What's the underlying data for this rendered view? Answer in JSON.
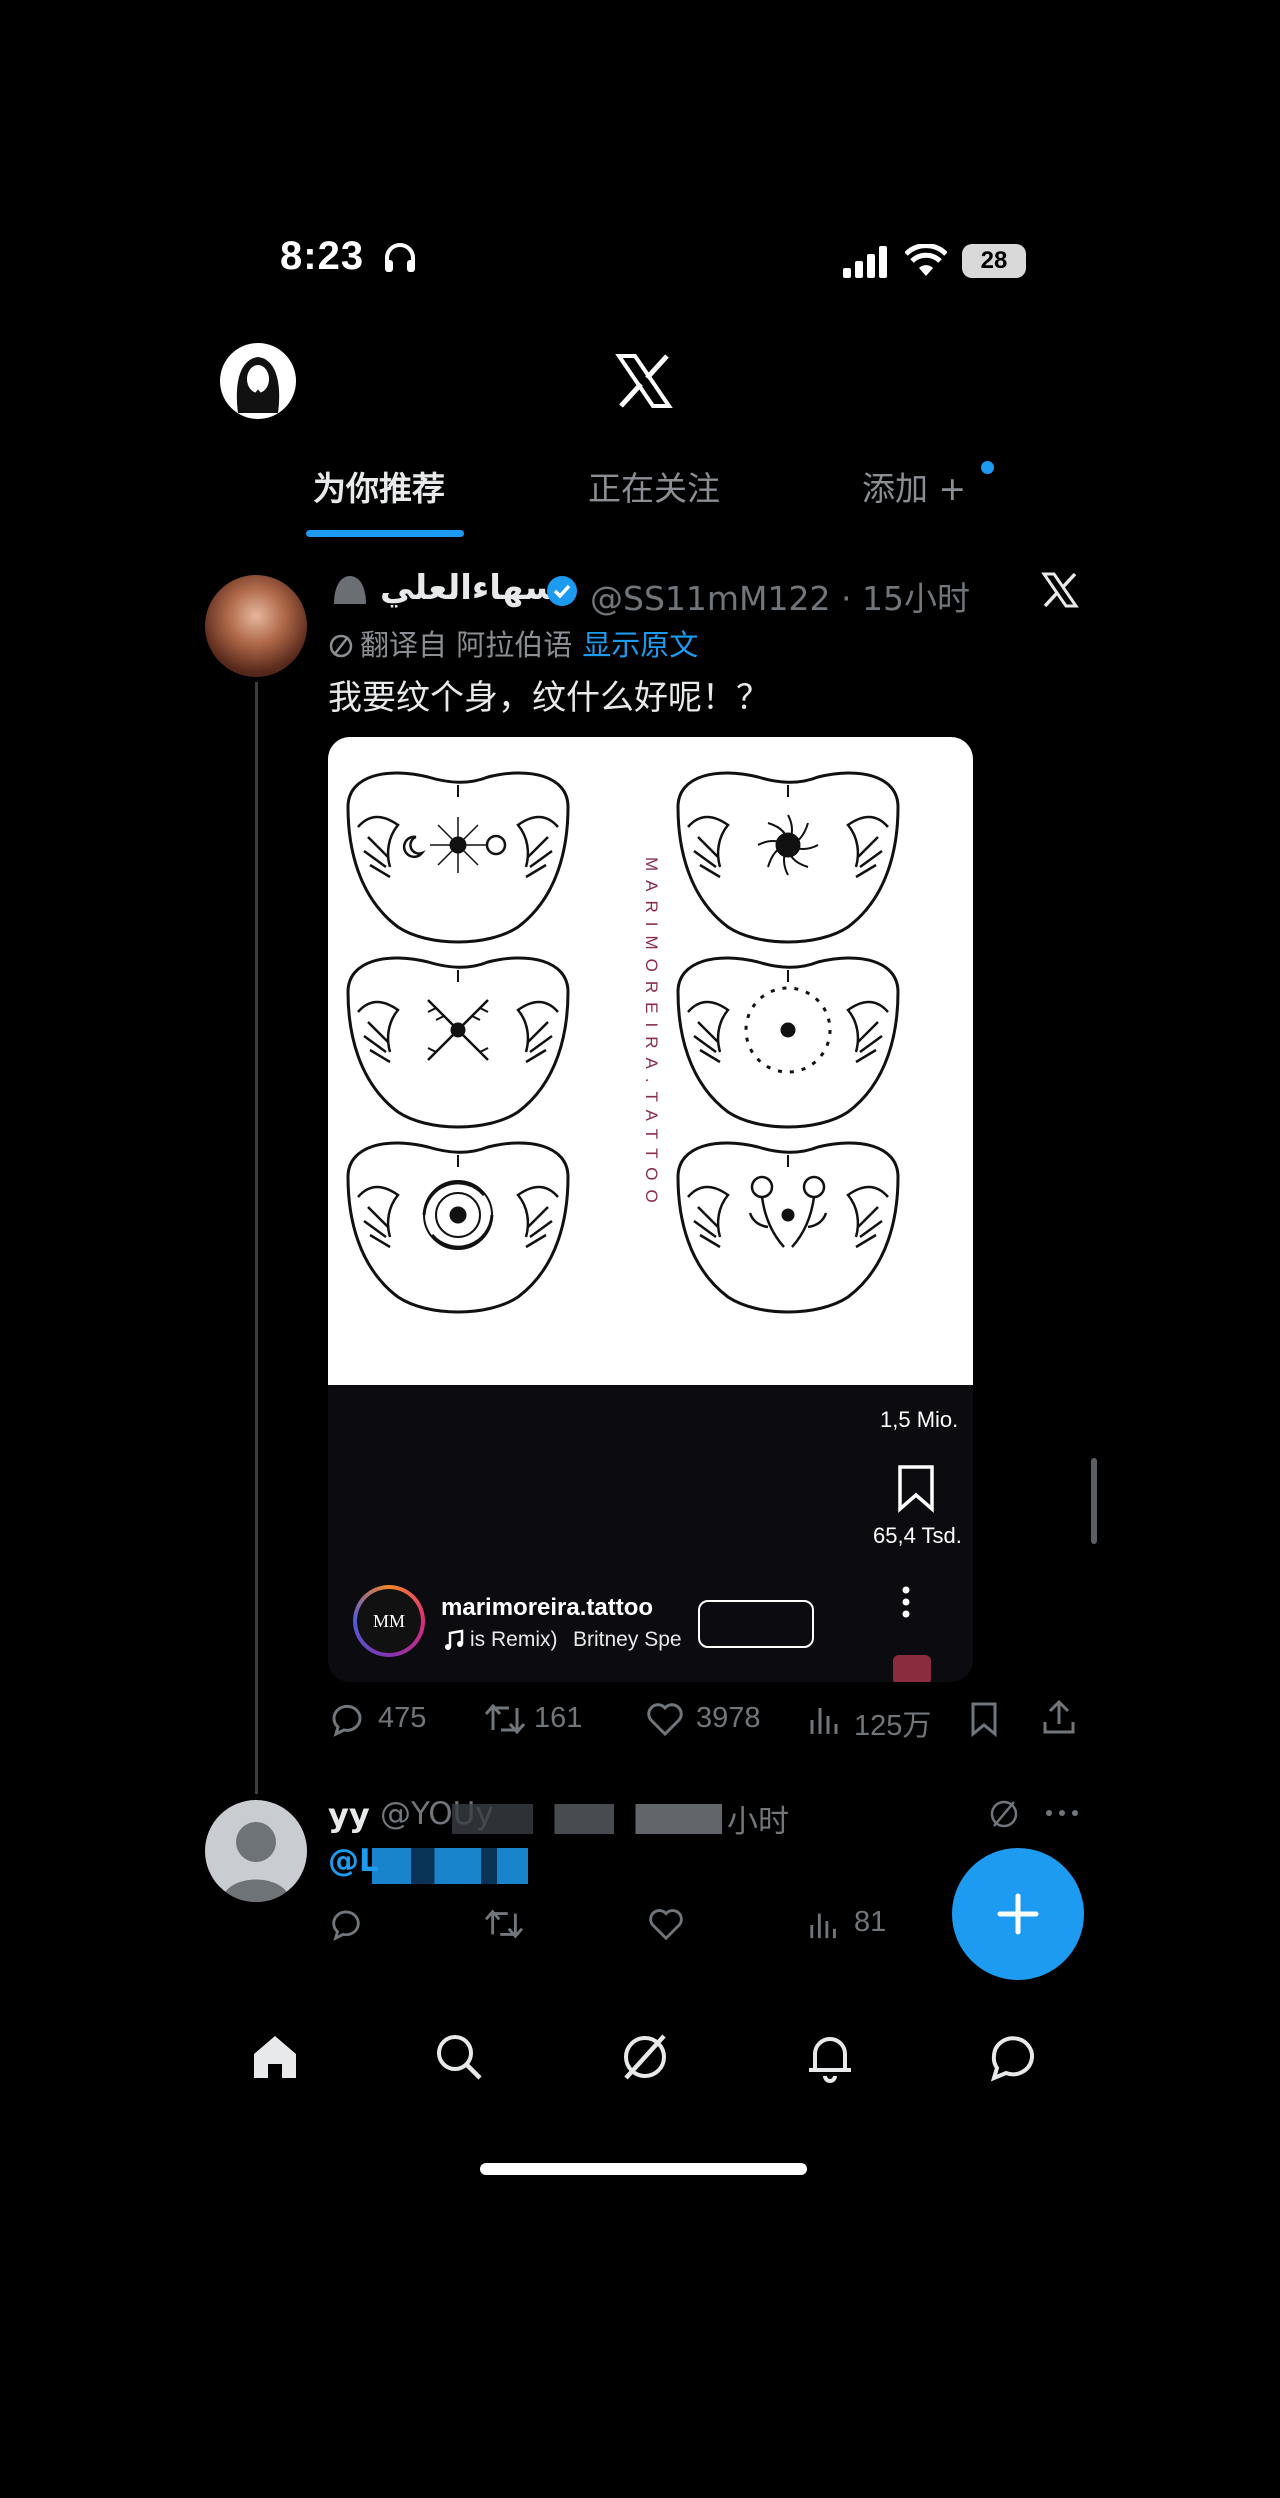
{
  "status_bar": {
    "time": "8:23",
    "battery": "28"
  },
  "tabs": [
    {
      "label": "为你推荐",
      "active": true
    },
    {
      "label": "正在关注",
      "active": false
    },
    {
      "label": "添加 +",
      "active": false
    }
  ],
  "post": {
    "display_name": "سهاءالعلي",
    "handle_time": "@SS11mM122 · 15小时",
    "translated_from": "翻译自 阿拉伯语",
    "show_original": "显示原文",
    "text": "我要纹个身，纹什么好呢！？",
    "media": {
      "watermark": "MARIMOREIRA.TATTOO",
      "likes_count": "1,5 Mio.",
      "saves_count": "65,4 Tsd.",
      "account_name": "marimoreira.tattoo",
      "song_part1": "is Remix)",
      "song_part2": "Britney Spe",
      "logo_text": "MM"
    },
    "actions": {
      "replies": "475",
      "reposts": "161",
      "likes": "3978",
      "views": "125万"
    }
  },
  "post2": {
    "display_name": "yy",
    "handle": "@YOUy",
    "time": "小时",
    "mention": "@L",
    "views": "81"
  },
  "colors": {
    "accent": "#1d9bf0",
    "background": "#000000",
    "text": "#e7e9ea",
    "muted": "#71767b"
  },
  "icons": [
    "headphones-icon",
    "signal-icon",
    "wifi-icon",
    "x-logo-icon",
    "verified-icon",
    "grok-icon",
    "reply-icon",
    "repost-icon",
    "like-icon",
    "views-icon",
    "bookmark-icon",
    "share-icon",
    "compose-icon",
    "home-icon",
    "search-icon",
    "explore-icon",
    "bell-icon",
    "messages-icon"
  ]
}
